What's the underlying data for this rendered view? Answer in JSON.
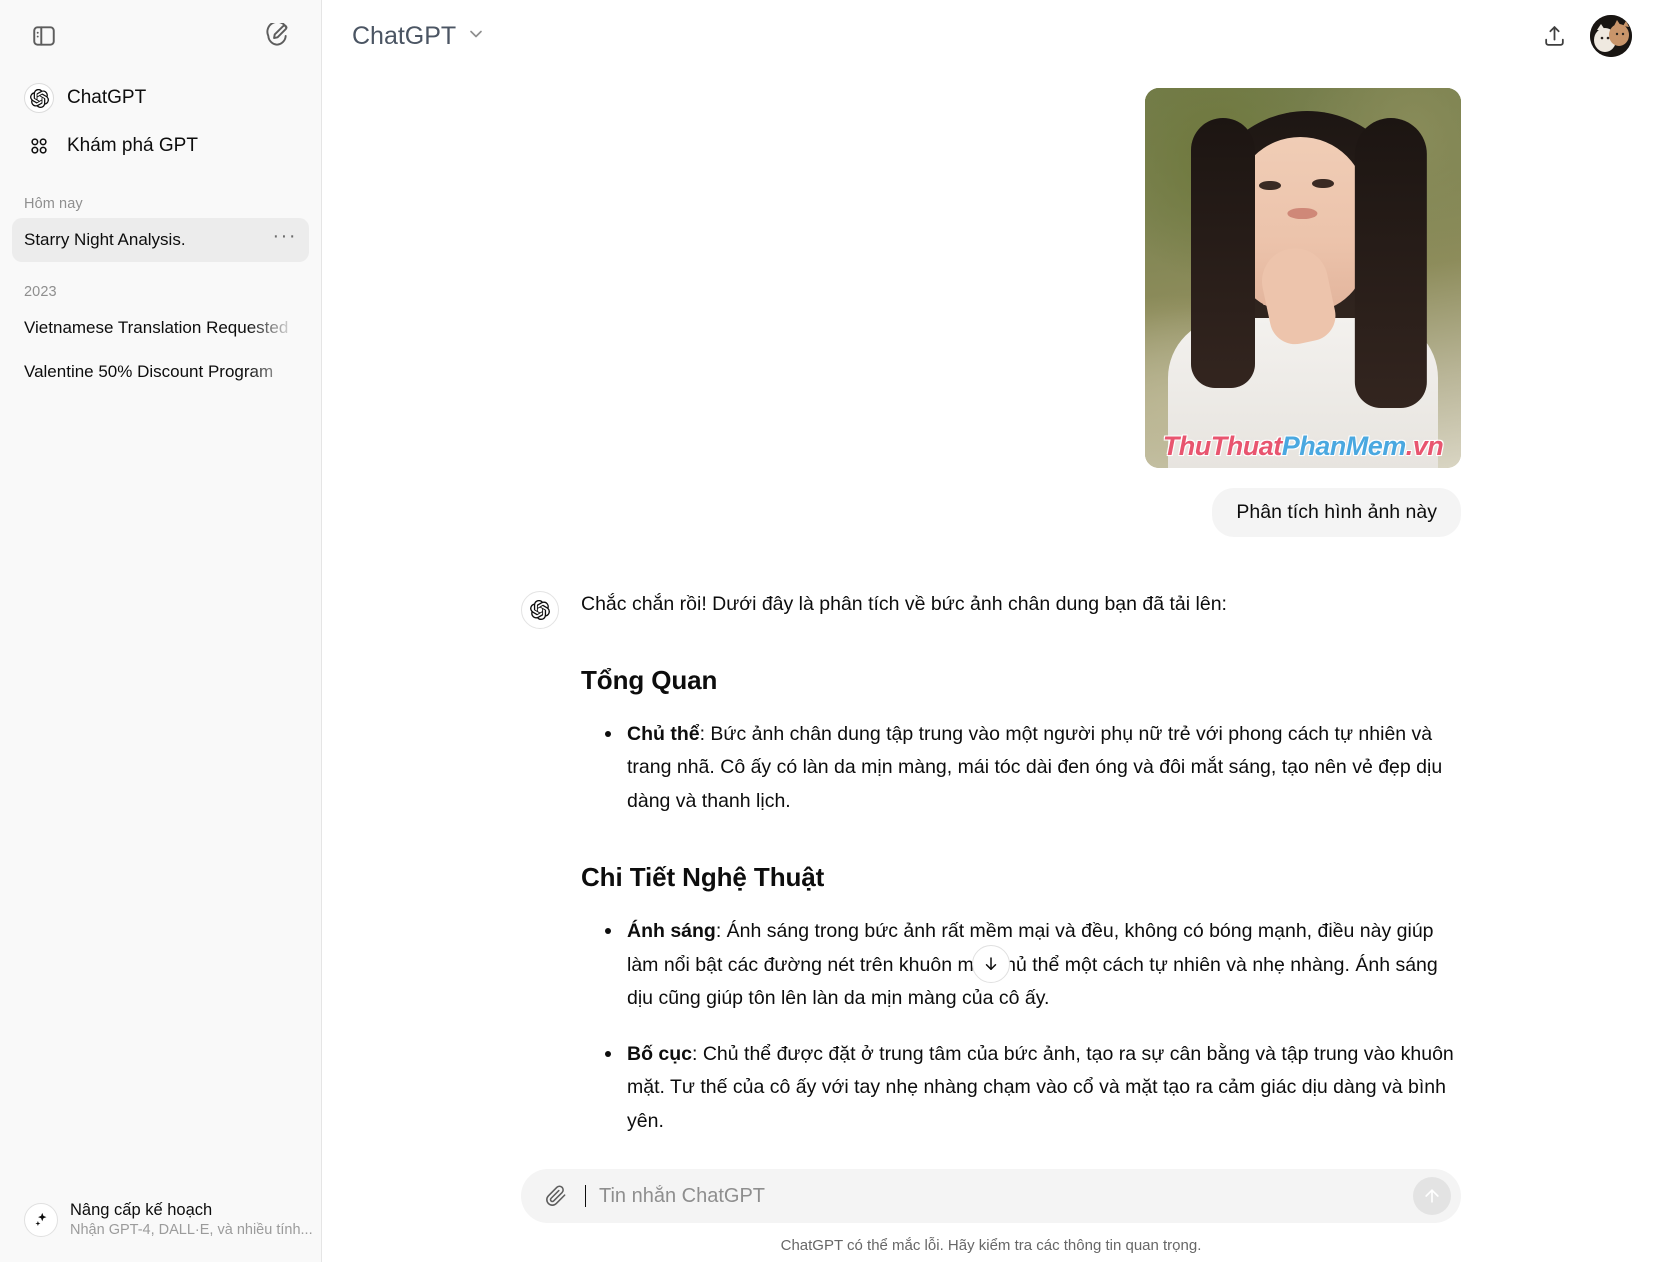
{
  "sidebar": {
    "toggle_icon": "sidebar-toggle-icon",
    "new_chat_icon": "new-chat-pencil-icon",
    "nav": [
      {
        "label": "ChatGPT",
        "icon": "openai-logo-icon"
      },
      {
        "label": "Khám phá GPT",
        "icon": "grid-dots-icon"
      }
    ],
    "groups": [
      {
        "label": "Hôm nay",
        "items": [
          {
            "title": "Starry Night Analysis.",
            "active": true,
            "menu": "···"
          }
        ]
      },
      {
        "label": "2023",
        "items": [
          {
            "title": "Vietnamese Translation Requested",
            "active": false
          },
          {
            "title": "Valentine 50% Discount Program",
            "active": false
          }
        ]
      }
    ],
    "upgrade": {
      "icon": "sparkles-icon",
      "title": "Nâng cấp kế hoạch",
      "subtitle": "Nhận GPT-4, DALL·E, và nhiều tính..."
    }
  },
  "topbar": {
    "model": "ChatGPT",
    "chevron_icon": "chevron-down-icon",
    "share_icon": "share-upload-icon",
    "avatar_icon": "user-avatar"
  },
  "conversation": {
    "user": {
      "image_watermark": {
        "part1": "ThuThuat",
        "part2": "PhanMem",
        "part3": ".vn"
      },
      "message": "Phân tích hình ảnh này"
    },
    "assistant": {
      "avatar_icon": "openai-logo-icon",
      "intro": "Chắc chắn rồi! Dưới đây là phân tích về bức ảnh chân dung bạn đã tải lên:",
      "sections": [
        {
          "heading": "Tổng Quan",
          "bullets": [
            {
              "term": "Chủ thể",
              "text": ": Bức ảnh chân dung tập trung vào một người phụ nữ trẻ với phong cách tự nhiên và trang nhã. Cô ấy có làn da mịn màng, mái tóc dài đen óng và đôi mắt sáng, tạo nên vẻ đẹp dịu dàng và thanh lịch."
            }
          ]
        },
        {
          "heading": "Chi Tiết Nghệ Thuật",
          "bullets": [
            {
              "term": "Ánh sáng",
              "text": ": Ánh sáng trong bức ảnh rất mềm mại và đều, không có bóng mạnh, điều này giúp làm nổi bật các đường nét trên khuôn mặt chủ thể một cách tự nhiên và nhẹ nhàng. Ánh sáng dịu cũng giúp tôn lên làn da mịn màng của cô ấy."
            },
            {
              "term": "Bố cục",
              "text": ": Chủ thể được đặt ở trung tâm của bức ảnh, tạo ra sự cân bằng và tập trung vào khuôn mặt. Tư thế của cô ấy với tay nhẹ nhàng chạm vào cổ và mặt tạo ra cảm giác dịu dàng và bình yên."
            }
          ]
        }
      ]
    }
  },
  "scroll_button": {
    "icon": "arrow-down-icon"
  },
  "composer": {
    "attach_icon": "paperclip-icon",
    "placeholder": "Tin nhắn ChatGPT",
    "value": "",
    "send_icon": "arrow-up-send-icon"
  },
  "footer": {
    "disclaimer": "ChatGPT có thể mắc lỗi. Hãy kiểm tra các thông tin quan trọng.",
    "help_label": "?"
  },
  "colors": {
    "sidebar_bg": "#f9f9f9",
    "bubble_bg": "#f4f4f4",
    "text": "#0d0d0d",
    "muted": "#8f8f8f"
  }
}
